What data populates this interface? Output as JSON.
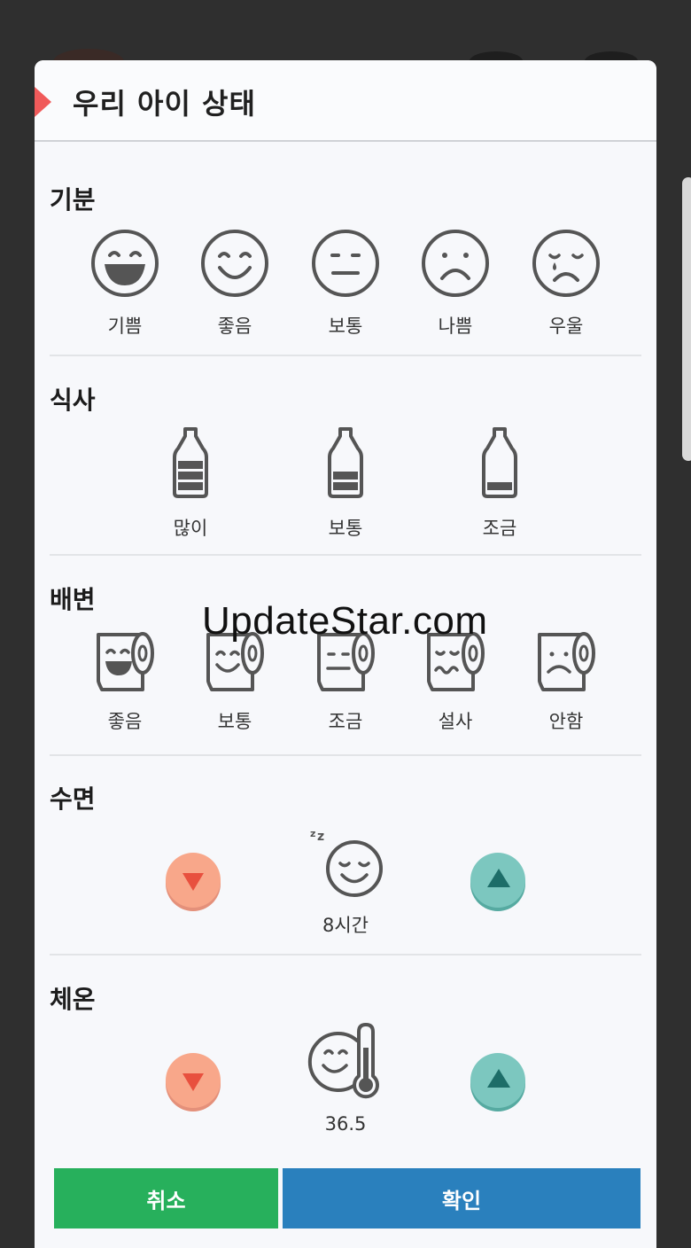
{
  "dialog": {
    "title": "우리 아이 상태",
    "mood": {
      "title": "기분",
      "options": [
        "기쁨",
        "좋음",
        "보통",
        "나쁨",
        "우울"
      ]
    },
    "meal": {
      "title": "식사",
      "options": [
        "많이",
        "보통",
        "조금"
      ]
    },
    "bowel": {
      "title": "배변",
      "options": [
        "좋음",
        "보통",
        "조금",
        "설사",
        "안함"
      ]
    },
    "sleep": {
      "title": "수면",
      "value": "8시간"
    },
    "temperature": {
      "title": "체온",
      "value": "36.5"
    },
    "buttons": {
      "cancel": "취소",
      "confirm": "확인"
    }
  },
  "watermark": "UpdateStar.com",
  "colors": {
    "accent_marker": "#f05a5a",
    "cancel": "#27b05c",
    "confirm": "#2a80bd",
    "down_button": "#f8a78a",
    "up_button": "#7cc7bf"
  },
  "icons": {
    "mood": [
      "big-smile-face-icon",
      "smile-face-icon",
      "neutral-face-icon",
      "sad-face-icon",
      "crying-face-icon"
    ],
    "meal": [
      "bottle-full-icon",
      "bottle-half-icon",
      "bottle-low-icon"
    ],
    "bowel": [
      "toilet-roll-big-smile-icon",
      "toilet-roll-smile-icon",
      "toilet-roll-neutral-icon",
      "toilet-roll-wavy-icon",
      "toilet-roll-sad-icon"
    ],
    "sleep": "sleeping-face-icon",
    "temperature": "face-thermometer-icon"
  }
}
